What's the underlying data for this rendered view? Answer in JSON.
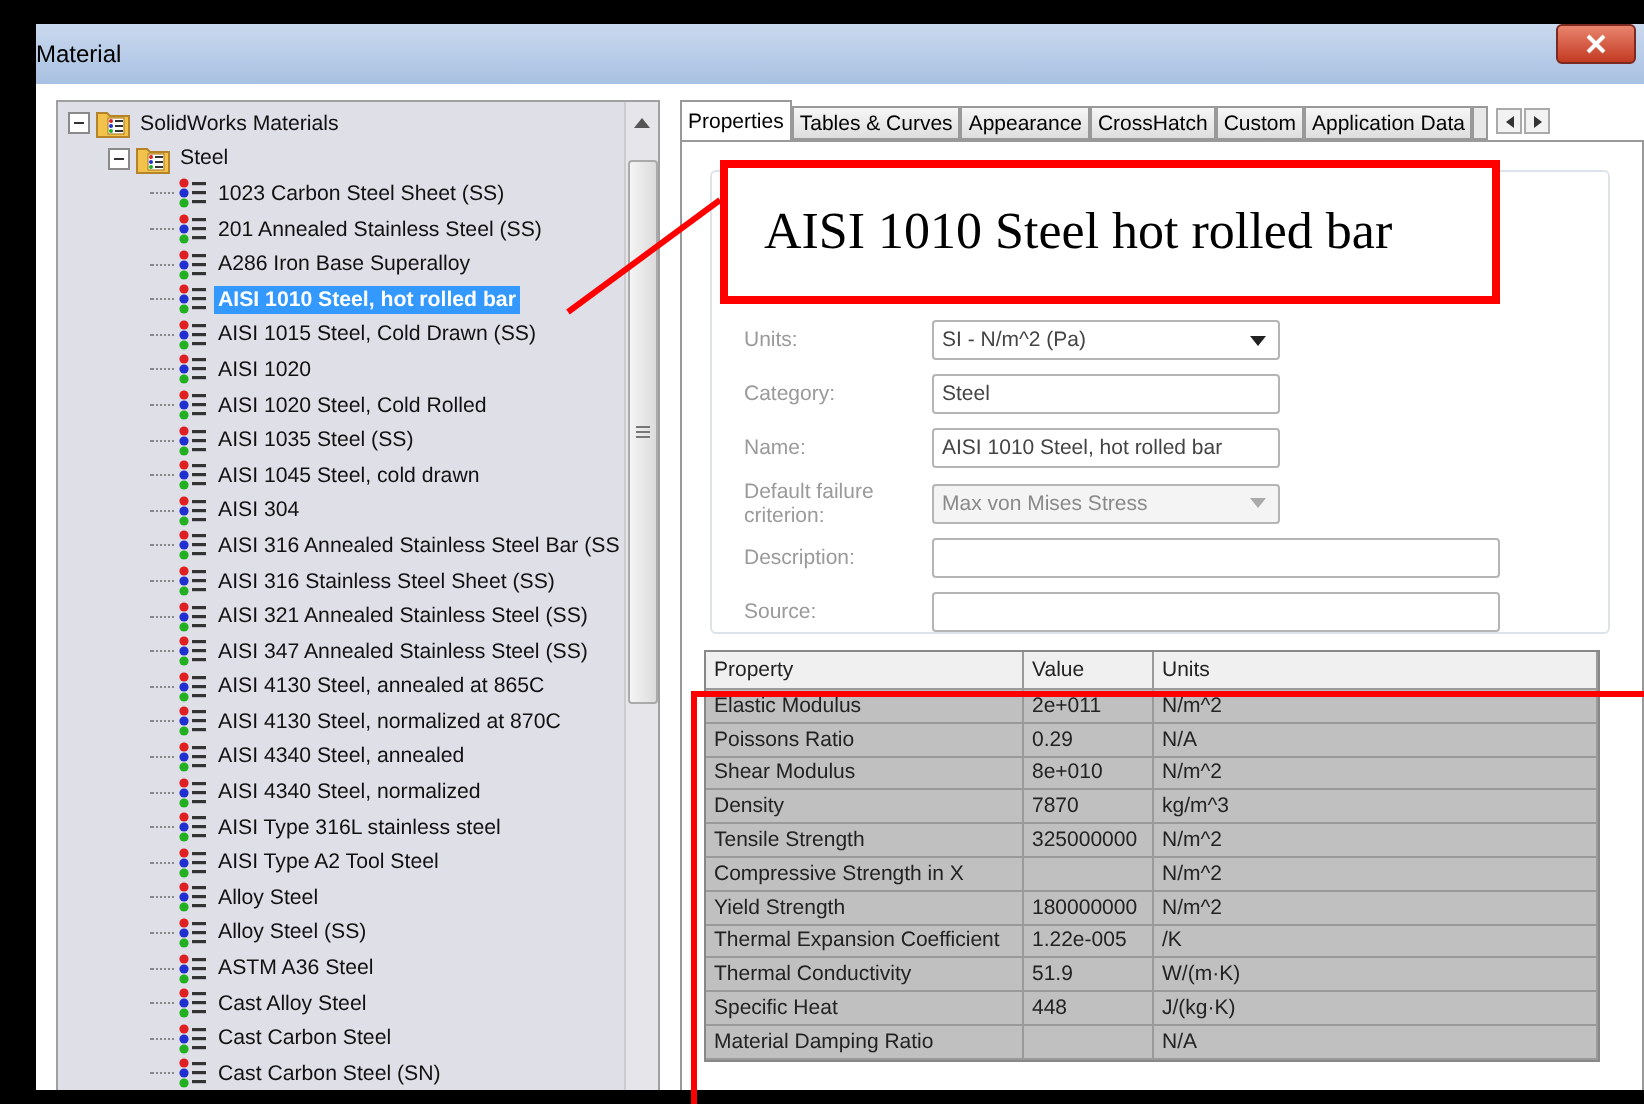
{
  "window": {
    "title": "Material"
  },
  "tree": {
    "label": "SolidWorks Materials",
    "expanded": true,
    "children": [
      {
        "label": "Steel",
        "expanded": true,
        "children": [
          {
            "label": "1023 Carbon Steel Sheet (SS)",
            "selected": false
          },
          {
            "label": "201 Annealed Stainless Steel (SS)",
            "selected": false
          },
          {
            "label": "A286 Iron Base Superalloy",
            "selected": false
          },
          {
            "label": "AISI 1010 Steel, hot rolled bar",
            "selected": true
          },
          {
            "label": "AISI 1015 Steel, Cold Drawn (SS)",
            "selected": false
          },
          {
            "label": "AISI 1020",
            "selected": false
          },
          {
            "label": "AISI 1020 Steel, Cold Rolled",
            "selected": false
          },
          {
            "label": "AISI 1035 Steel (SS)",
            "selected": false
          },
          {
            "label": "AISI 1045 Steel, cold drawn",
            "selected": false
          },
          {
            "label": "AISI 304",
            "selected": false
          },
          {
            "label": "AISI 316 Annealed Stainless Steel Bar (SS",
            "selected": false
          },
          {
            "label": "AISI 316 Stainless Steel Sheet (SS)",
            "selected": false
          },
          {
            "label": "AISI 321 Annealed Stainless Steel (SS)",
            "selected": false
          },
          {
            "label": "AISI 347 Annealed Stainless Steel (SS)",
            "selected": false
          },
          {
            "label": "AISI 4130 Steel, annealed at 865C",
            "selected": false
          },
          {
            "label": "AISI 4130 Steel, normalized at 870C",
            "selected": false
          },
          {
            "label": "AISI 4340 Steel, annealed",
            "selected": false
          },
          {
            "label": "AISI 4340 Steel, normalized",
            "selected": false
          },
          {
            "label": "AISI Type 316L stainless steel",
            "selected": false
          },
          {
            "label": "AISI Type A2 Tool Steel",
            "selected": false
          },
          {
            "label": "Alloy Steel",
            "selected": false
          },
          {
            "label": "Alloy Steel (SS)",
            "selected": false
          },
          {
            "label": "ASTM A36 Steel",
            "selected": false
          },
          {
            "label": "Cast Alloy Steel",
            "selected": false
          },
          {
            "label": "Cast Carbon Steel",
            "selected": false
          },
          {
            "label": "Cast Carbon Steel (SN)",
            "selected": false
          }
        ]
      }
    ]
  },
  "tabs": [
    {
      "label": "Properties",
      "selected": true
    },
    {
      "label": "Tables & Curves",
      "selected": false
    },
    {
      "label": "Appearance",
      "selected": false
    },
    {
      "label": "CrossHatch",
      "selected": false
    },
    {
      "label": "Custom",
      "selected": false
    },
    {
      "label": "Application Data",
      "selected": false
    }
  ],
  "form": [
    {
      "label": "Units:",
      "kind": "dropdown",
      "value": "SI - N/m^2 (Pa)",
      "disabled": false
    },
    {
      "label": "Category:",
      "kind": "text",
      "value": "Steel"
    },
    {
      "label": "Name:",
      "kind": "text",
      "value": "AISI 1010 Steel, hot rolled bar"
    },
    {
      "label": "Default failure criterion:",
      "kind": "dropdown",
      "value": "Max von Mises Stress",
      "disabled": true
    },
    {
      "label": "Description:",
      "kind": "wide"
    },
    {
      "label": "Source:",
      "kind": "wide"
    }
  ],
  "table": {
    "columns": [
      "Property",
      "Value",
      "Units"
    ],
    "rows": [
      [
        "Elastic Modulus",
        "2e+011",
        "N/m^2"
      ],
      [
        "Poissons Ratio",
        "0.29",
        "N/A"
      ],
      [
        "Shear Modulus",
        "8e+010",
        "N/m^2"
      ],
      [
        "Density",
        "7870",
        "kg/m^3"
      ],
      [
        "Tensile Strength",
        "325000000",
        "N/m^2"
      ],
      [
        "Compressive Strength in X",
        "",
        "N/m^2"
      ],
      [
        "Yield Strength",
        "180000000",
        "N/m^2"
      ],
      [
        "Thermal Expansion Coefficient",
        "1.22e-005",
        "/K"
      ],
      [
        "Thermal Conductivity",
        "51.9",
        "W/(m·K)"
      ],
      [
        "Specific Heat",
        "448",
        "J/(kg·K)"
      ],
      [
        "Material Damping Ratio",
        "",
        "N/A"
      ]
    ]
  },
  "callout": {
    "text": "AISI 1010 Steel hot rolled bar"
  }
}
